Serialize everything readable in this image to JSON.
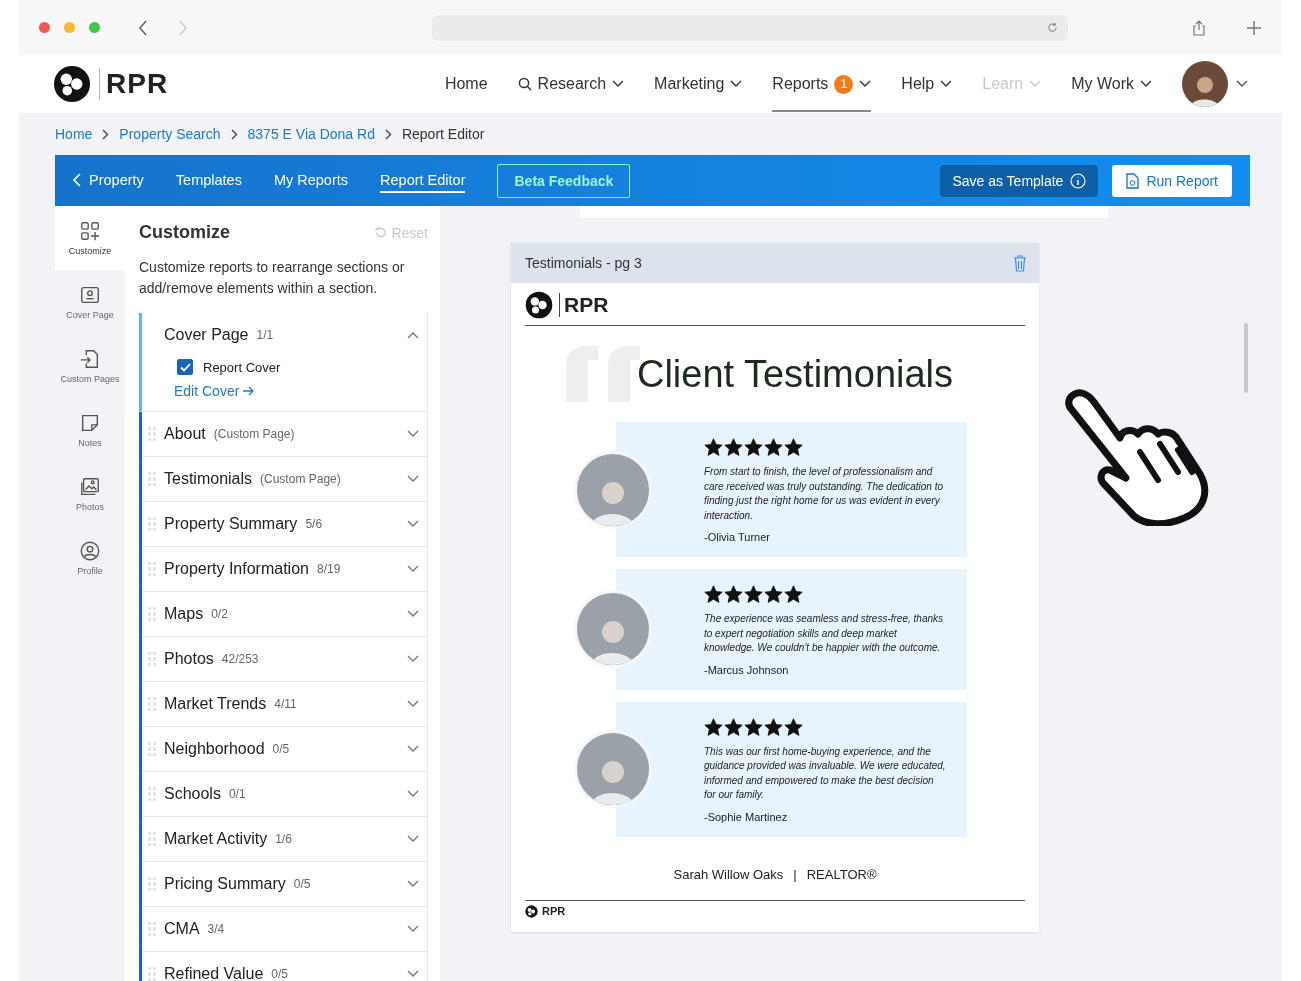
{
  "brand": {
    "name": "RPR"
  },
  "nav": [
    {
      "label": "Home",
      "dropdown": false,
      "selected": false,
      "disabled": false
    },
    {
      "label": "Research",
      "dropdown": true,
      "selected": false,
      "disabled": false,
      "search": true
    },
    {
      "label": "Marketing",
      "dropdown": true,
      "selected": false,
      "disabled": false
    },
    {
      "label": "Reports",
      "dropdown": true,
      "selected": true,
      "disabled": false,
      "badge": "1"
    },
    {
      "label": "Help",
      "dropdown": true,
      "selected": false,
      "disabled": false
    },
    {
      "label": "Learn",
      "dropdown": true,
      "selected": false,
      "disabled": true
    },
    {
      "label": "My Work",
      "dropdown": true,
      "selected": false,
      "disabled": false
    }
  ],
  "breadcrumbs": [
    {
      "label": "Home",
      "current": false
    },
    {
      "label": "Property Search",
      "current": false
    },
    {
      "label": "8375 E Via Dona Rd",
      "current": false
    },
    {
      "label": "Report Editor",
      "current": true
    }
  ],
  "toolbar": {
    "tabs": [
      {
        "label": "Property",
        "selected": false,
        "back": true
      },
      {
        "label": "Templates",
        "selected": false
      },
      {
        "label": "My Reports",
        "selected": false
      },
      {
        "label": "Report Editor",
        "selected": true
      }
    ],
    "feedback_button": "Beta Feedback",
    "template_button": "Save as Template",
    "run_button": "Run Report"
  },
  "rail": [
    {
      "label": "Customize",
      "selected": true
    },
    {
      "label": "Cover Page",
      "selected": false
    },
    {
      "label": "Custom Pages",
      "selected": false
    },
    {
      "label": "Notes",
      "selected": false
    },
    {
      "label": "Photos",
      "selected": false
    },
    {
      "label": "Profile",
      "selected": false
    }
  ],
  "panel": {
    "title": "Customize",
    "reset": "Reset",
    "description": "Customize reports to rearrange sections or add/remove elements within a section.",
    "sections": [
      {
        "title": "Cover Page",
        "detail": "1/1",
        "expanded": true,
        "items": [
          {
            "label": "Report Cover",
            "checked": true
          }
        ],
        "link": "Edit Cover"
      },
      {
        "title": "About",
        "detail": "(Custom Page)",
        "expanded": false
      },
      {
        "title": "Testimonials",
        "detail": "(Custom Page)",
        "expanded": false
      },
      {
        "title": "Property Summary",
        "detail": "5/6",
        "expanded": false
      },
      {
        "title": "Property Information",
        "detail": "8/19",
        "expanded": false
      },
      {
        "title": "Maps",
        "detail": "0/2",
        "expanded": false
      },
      {
        "title": "Photos",
        "detail": "42/253",
        "expanded": false
      },
      {
        "title": "Market Trends",
        "detail": "4/11",
        "expanded": false
      },
      {
        "title": "Neighborhood",
        "detail": "0/5",
        "expanded": false
      },
      {
        "title": "Schools",
        "detail": "0/1",
        "expanded": false
      },
      {
        "title": "Market Activity",
        "detail": "1/6",
        "expanded": false
      },
      {
        "title": "Pricing Summary",
        "detail": "0/5",
        "expanded": false
      },
      {
        "title": "CMA",
        "detail": "3/4",
        "expanded": false
      },
      {
        "title": "Refined Value",
        "detail": "0/5",
        "expanded": false
      }
    ]
  },
  "page": {
    "header": "Testimonials - pg 3",
    "logo": "RPR",
    "title": "Client Testimonials",
    "testimonials": [
      {
        "stars": 5,
        "quote": "From start to finish, the level of professionalism and care received was truly outstanding. The dedication to finding just the right home for us was evident in every interaction.",
        "author": "-Olivia Turner"
      },
      {
        "stars": 5,
        "quote": "The experience was seamless and stress-free, thanks to expert negotiation skills and deep market knowledge. We couldn't be happier with the outcome.",
        "author": "-Marcus Johnson"
      },
      {
        "stars": 5,
        "quote": "This was our first home-buying experience, and the guidance provided was invaluable. We were educated, informed and empowered to make the best decision for our family.",
        "author": "-Sophie Martinez"
      }
    ],
    "agent": "Sarah Willow Oaks",
    "separator": "|",
    "agent_title": "REALTOR®",
    "footer_logo": "RPR"
  }
}
